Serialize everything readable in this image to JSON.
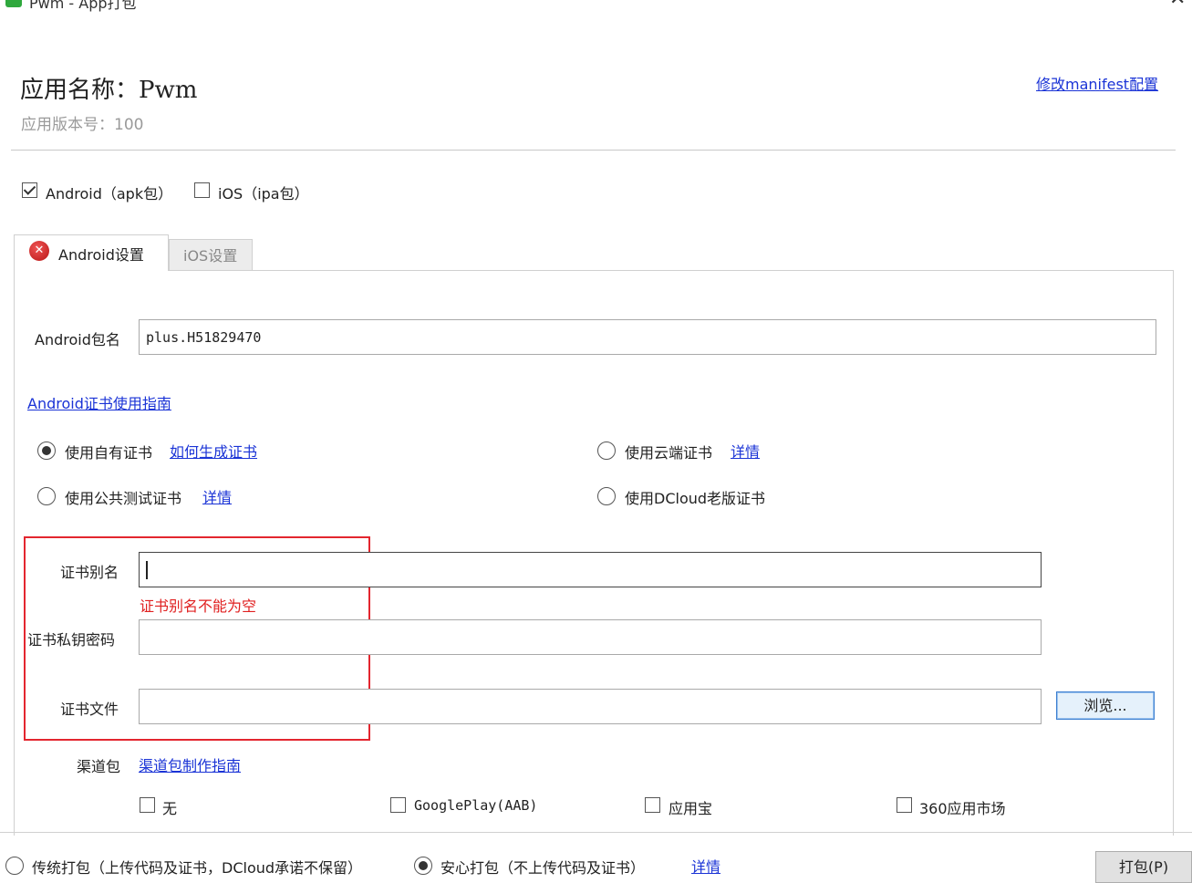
{
  "window": {
    "title": "Pwm - App打包"
  },
  "header": {
    "app_name": "应用名称：Pwm",
    "app_version": "应用版本号：100",
    "manifest_link": "修改manifest配置"
  },
  "platforms": {
    "android": {
      "label": "Android（apk包）",
      "checked": true
    },
    "ios": {
      "label": "iOS（ipa包）",
      "checked": false
    }
  },
  "tabs": [
    {
      "label": "Android设置",
      "active": true,
      "has_error": true
    },
    {
      "label": "iOS设置",
      "active": false
    }
  ],
  "android": {
    "package_label": "Android包名",
    "package_value": "plus.H51829470",
    "cert_guide_link": "Android证书使用指南",
    "cert_options": [
      {
        "label": "使用自有证书",
        "link": "如何生成证书",
        "selected": true
      },
      {
        "label": "使用云端证书",
        "link": "详情",
        "selected": false
      },
      {
        "label": "使用公共测试证书",
        "link": "详情",
        "selected": false
      },
      {
        "label": "使用DCloud老版证书",
        "link": "",
        "selected": false
      }
    ],
    "alias_label": "证书别名",
    "alias_value": "",
    "alias_error": "证书别名不能为空",
    "password_label": "证书私钥密码",
    "password_value": "",
    "file_label": "证书文件",
    "file_value": "",
    "browse_label": "浏览...",
    "channel_label": "渠道包",
    "channel_link": "渠道包制作指南",
    "channels": [
      {
        "label": "无",
        "checked": false
      },
      {
        "label": "GooglePlay(AAB)",
        "checked": false
      },
      {
        "label": "应用宝",
        "checked": false
      },
      {
        "label": "360应用市场",
        "checked": false
      }
    ]
  },
  "footer": {
    "mode_options": [
      {
        "label": "传统打包（上传代码及证书，DCloud承诺不保留）",
        "selected": false
      },
      {
        "label": "安心打包（不上传代码及证书）",
        "selected": true
      }
    ],
    "details_link": "详情",
    "pack_button": "打包(P)"
  }
}
